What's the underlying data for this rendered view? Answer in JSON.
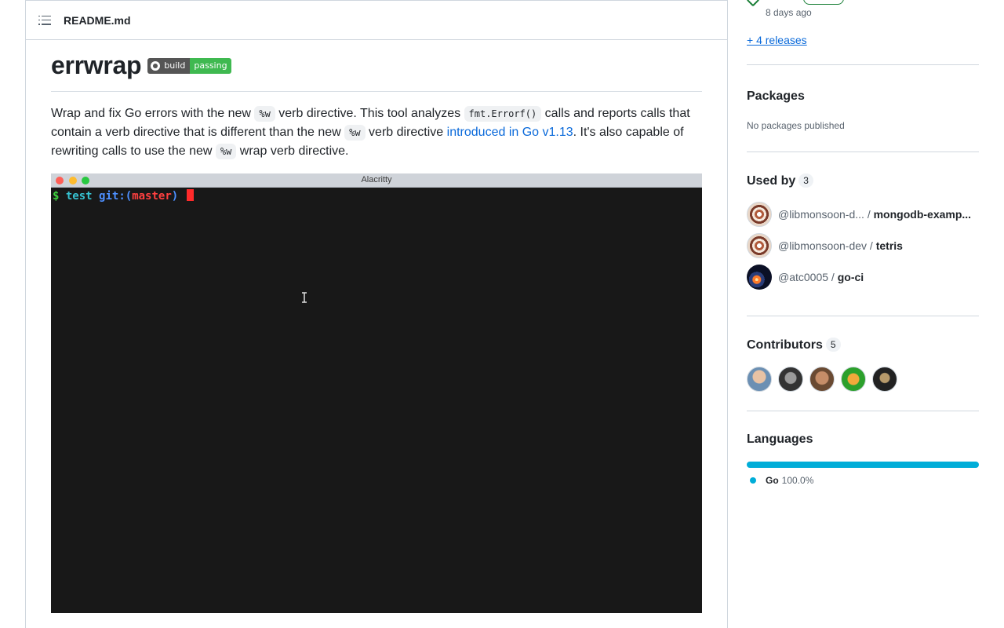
{
  "readme": {
    "filename": "README.md",
    "title": "errwrap",
    "badge": {
      "left": "build",
      "right": "passing"
    },
    "paragraph": {
      "p1": "Wrap and fix Go errors with the new ",
      "code1": "%w",
      "p2": " verb directive. This tool analyzes ",
      "code2": "fmt.Errorf()",
      "p3": " calls and reports calls that contain a verb directive that is different than the new ",
      "code3": "%w",
      "p4": " verb directive ",
      "link": "introduced in Go v1.13",
      "p5": ". It's also capable of rewriting calls to use the new ",
      "code4": "%w",
      "p6": " wrap verb directive."
    },
    "terminal": {
      "window_title": "Alacritty",
      "prompt_symbol": "$",
      "dir": "test",
      "git_prefix": "git:(",
      "branch": "master",
      "git_suffix": ")"
    }
  },
  "sidebar": {
    "release": {
      "date": "8 days ago",
      "more_link": "+ 4 releases"
    },
    "packages": {
      "title": "Packages",
      "empty": "No packages published"
    },
    "used_by": {
      "title": "Used by",
      "count": "3",
      "items": [
        {
          "owner": "@libmonsoon-d...",
          "sep": " / ",
          "repo": "mongodb-examp..."
        },
        {
          "owner": "@libmonsoon-dev",
          "sep": " / ",
          "repo": "tetris"
        },
        {
          "owner": "@atc0005",
          "sep": " / ",
          "repo": "go-ci"
        }
      ]
    },
    "contributors": {
      "title": "Contributors",
      "count": "5"
    },
    "languages": {
      "title": "Languages",
      "items": [
        {
          "name": "Go",
          "percent": "100.0%",
          "color": "#00add8",
          "fraction": 1.0
        }
      ]
    }
  },
  "colors": {
    "link": "#0969da",
    "go": "#00add8",
    "badge_green": "#3fb950",
    "terminal_bg": "#181818"
  }
}
